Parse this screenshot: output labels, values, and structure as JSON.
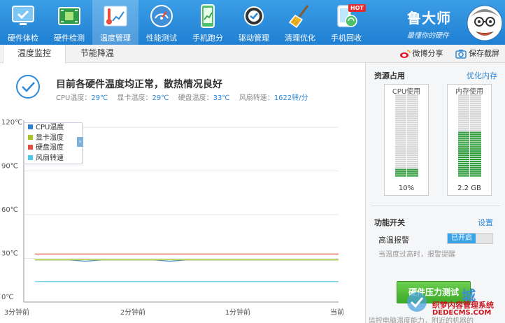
{
  "toolbar": {
    "items": [
      {
        "label": "硬件体检",
        "icon": "monitor-check-icon"
      },
      {
        "label": "硬件检测",
        "icon": "circuit-board-icon"
      },
      {
        "label": "温度管理",
        "icon": "thermometer-icon",
        "active": true
      },
      {
        "label": "性能测试",
        "icon": "speedometer-icon"
      },
      {
        "label": "手机跑分",
        "icon": "phone-chart-icon"
      },
      {
        "label": "驱动管理",
        "icon": "gear-icon"
      },
      {
        "label": "清理优化",
        "icon": "broom-icon"
      },
      {
        "label": "手机回收",
        "icon": "phone-recycle-icon"
      }
    ],
    "hot_badge": "HOT"
  },
  "brand": {
    "name": "鲁大师",
    "slogan": "最懂你的硬件"
  },
  "tabs": [
    {
      "label": "温度监控",
      "active": true
    },
    {
      "label": "节能降温"
    }
  ],
  "actions": {
    "share": "微博分享",
    "screenshot": "保存截屏"
  },
  "status": {
    "headline": "目前各硬件温度均正常，散热情况良好",
    "metrics": [
      {
        "label": "CPU温度：",
        "value": "29℃"
      },
      {
        "label": "显卡温度：",
        "value": "29℃"
      },
      {
        "label": "硬盘温度：",
        "value": "33℃"
      },
      {
        "label": "风扇转速：",
        "value": "1622转/分"
      }
    ]
  },
  "chart_data": {
    "type": "line",
    "y_ticks": [
      "0℃",
      "30℃",
      "60℃",
      "90℃",
      "120℃"
    ],
    "ylim": [
      0,
      120
    ],
    "x_ticks": [
      "3分钟前",
      "2分钟前",
      "1分钟前",
      "当前"
    ],
    "legend": [
      {
        "name": "CPU温度",
        "color": "#2f7ed8"
      },
      {
        "name": "显卡温度",
        "color": "#a7c520"
      },
      {
        "name": "硬盘温度",
        "color": "#e84c3d"
      },
      {
        "name": "风扇转速",
        "color": "#50c8e8"
      }
    ],
    "series": [
      {
        "name": "CPU温度",
        "values": [
          29,
          29,
          29,
          28,
          29,
          29,
          29,
          29,
          28,
          29,
          29,
          29,
          29,
          29,
          29,
          29,
          29,
          29,
          29
        ]
      },
      {
        "name": "显卡温度",
        "values": [
          29,
          29,
          29,
          29,
          29,
          29,
          29,
          29,
          29,
          29,
          29,
          29,
          29,
          29,
          29,
          29,
          29,
          29,
          29
        ]
      },
      {
        "name": "硬盘温度",
        "values": [
          33,
          33,
          33,
          33,
          33,
          33,
          33,
          33,
          33,
          33,
          33,
          33,
          33,
          33,
          33,
          33,
          33,
          33,
          33
        ]
      },
      {
        "name": "风扇转速",
        "values": [
          14,
          14,
          14,
          14,
          14,
          14,
          14,
          14,
          14,
          14,
          14,
          14,
          14,
          14,
          14,
          14,
          14,
          14,
          14
        ]
      }
    ],
    "grid": true
  },
  "resources": {
    "title": "资源占用",
    "optimize_link": "优化内存",
    "cpu": {
      "label": "CPU使用",
      "value": "10%",
      "fraction": 0.1
    },
    "memory": {
      "label": "内存使用",
      "value": "2.2 GB",
      "fraction": 0.55
    }
  },
  "features": {
    "title": "功能开关",
    "settings_link": "设置",
    "alarm_label": "高温报警",
    "toggle_state": "已开启",
    "alarm_desc": "当温度过高时，报警提醒"
  },
  "stress_button": "硬件压力测试",
  "footer_text": "监控电脑温度能力，附近的机器的",
  "watermark": {
    "cn": "织梦内容管理系统",
    "en": "DEDECMS.COM"
  },
  "colors": {
    "accent": "#2e89d6",
    "toolbar": "#2a8ede",
    "green": "#3ea92a"
  }
}
